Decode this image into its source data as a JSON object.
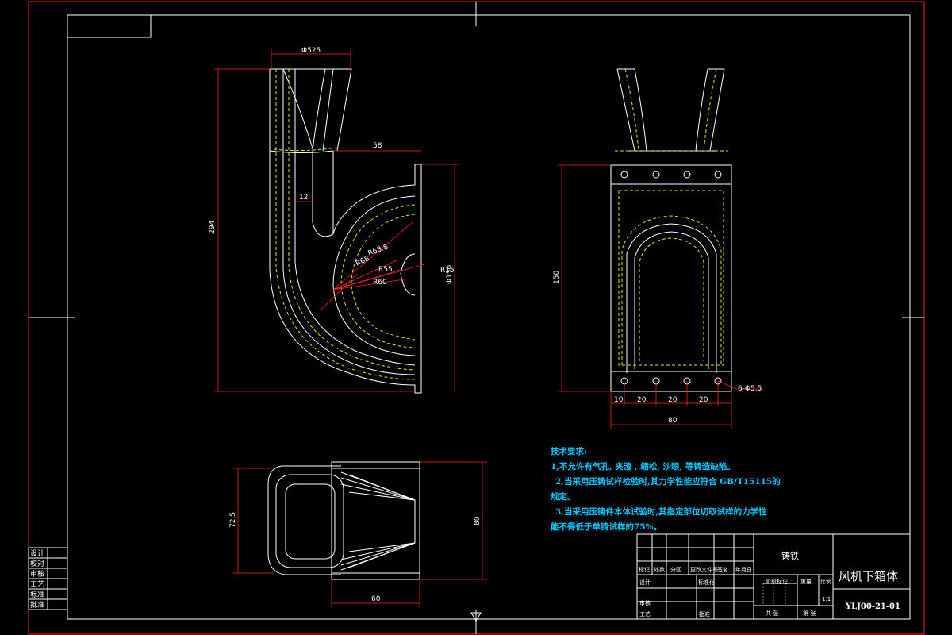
{
  "colors": {
    "border": "#ff2020",
    "frame": "#ffffff",
    "part": "#ffffff",
    "hidden": "#e6e600",
    "dim": "#ff2020",
    "dim_text": "#ffffff",
    "notes": "#00c8ff",
    "background": "#000000"
  },
  "dims": {
    "top_diameter": "Φ525",
    "height_total": "294",
    "flange_offset": "58",
    "wall": "12",
    "r_68": "R68",
    "r_68_8": "R68.8",
    "r_55": "R55",
    "r_60": "R60",
    "r_15": "R15",
    "phi_150": "Φ150",
    "side_height": "150",
    "hole_spec": "6-Φ5.5",
    "pitch_10": "10",
    "pitch_20a": "20",
    "pitch_20b": "20",
    "pitch_20c": "20",
    "overall_80_side": "80",
    "bottom_72_5": "72.5",
    "bottom_80": "80",
    "bottom_60": "60"
  },
  "notes": {
    "title": "技术要求:",
    "line1": "1,不允许有气孔, 夹渣 , 缩松, 沙眼, 等铸造缺陷。",
    "line2": "2,当采用压铸试样检验时,其力学性能应符合 GB/T15115的",
    "line2b": "规定。",
    "line3": "3,当采用压铸件本体试验时,其指定部位切取试样的力学性",
    "line3b": "能不得低于单铸试样的75%。"
  },
  "side_block": [
    "设计",
    "校对",
    "审核",
    "工艺",
    "标准",
    "批准"
  ],
  "title_block": {
    "material": "铸铁",
    "part_name": "风机下箱体",
    "drawing_number": "YLJ00-21-01",
    "stage_mark": "阶段标记",
    "weight": "重量",
    "scale_label": "比例",
    "scale": "1:1",
    "sheets_total": "共 张",
    "sheet_no": "第 张",
    "row_labels": [
      "标记",
      "处数",
      "分区",
      "更改文件号",
      "签名",
      "年月日"
    ],
    "design": "设计",
    "standardize": "标准化",
    "review": "审核",
    "process": "工艺",
    "approve": "批准"
  }
}
